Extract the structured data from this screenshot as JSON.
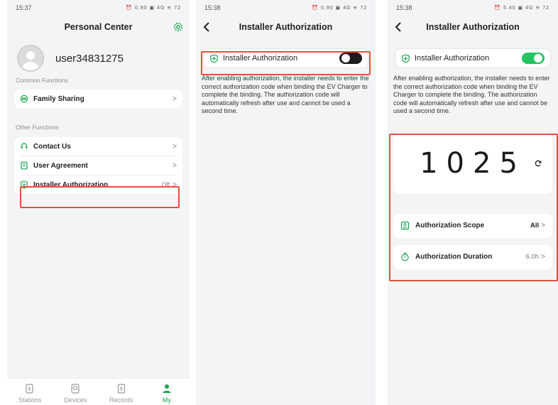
{
  "colors": {
    "accent": "#16a34a",
    "highlight": "#e0523d",
    "switch_on": "#22c55e",
    "switch_off": "#1d1d1d"
  },
  "screen1": {
    "time": "15:37",
    "status_icons": "⏰ 0.90 ▣ 4G ≋ 72",
    "title": "Personal Center",
    "username": "user34831275",
    "common_label": "Common Functions",
    "family_sharing": "Family Sharing",
    "other_label": "Other Functions",
    "contact_us": "Contact Us",
    "user_agreement": "User Agreement",
    "installer_authorization": "Installer Authorization",
    "installer_status": "Off",
    "chevron": ">",
    "tabs": [
      "Stations",
      "Devices",
      "Records",
      "My"
    ]
  },
  "screen2": {
    "time": "15:38",
    "status_icons": "⏰ 0.90 ▣ 4G ≋ 72",
    "title": "Installer Authorization",
    "toggle_label": "Installer Authorization",
    "description": "After enabling authorization, the installer needs to enter the correct authorization code when binding the EV Charger to complete the binding. The authorization code will automatically refresh after use and cannot be used a second time."
  },
  "screen3": {
    "time": "15:38",
    "status_icons": "⏰ 5.40 ▣ 4G ≋ 72",
    "title": "Installer Authorization",
    "toggle_label": "Installer Authorization",
    "description": "After enabling authorization, the installer needs to enter the correct authorization code when binding the EV Charger to complete the binding. The authorization code will automatically refresh after use and cannot be used a second time.",
    "code": "1025",
    "scope_label": "Authorization Scope",
    "scope_value": "All",
    "duration_label": "Authorization Duration",
    "duration_value": "6.0h",
    "chevron": ">"
  }
}
